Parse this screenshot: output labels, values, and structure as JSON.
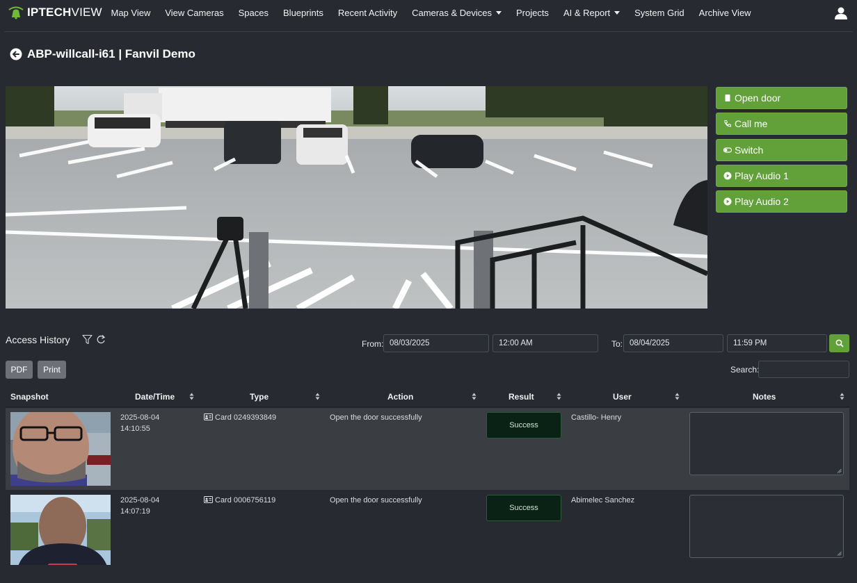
{
  "brand": {
    "bold": "IPTECH",
    "thin": "VIEW"
  },
  "nav": {
    "items": [
      {
        "label": "Map View"
      },
      {
        "label": "View Cameras"
      },
      {
        "label": "Spaces"
      },
      {
        "label": "Blueprints"
      },
      {
        "label": "Recent Activity"
      },
      {
        "label": "Cameras & Devices",
        "dropdown": true
      },
      {
        "label": "Projects"
      },
      {
        "label": "AI & Report",
        "dropdown": true
      },
      {
        "label": "System Grid"
      },
      {
        "label": "Archive View"
      }
    ]
  },
  "page": {
    "title": "ABP-willcall-i61 | Fanvil Demo"
  },
  "actions": [
    {
      "label": "Open door",
      "icon": "door-icon"
    },
    {
      "label": "Call me",
      "icon": "phone-icon"
    },
    {
      "label": "Switch",
      "icon": "toggle-icon"
    },
    {
      "label": "Play Audio 1",
      "icon": "play-circle-icon"
    },
    {
      "label": "Play Audio 2",
      "icon": "play-circle-icon"
    }
  ],
  "history": {
    "title": "Access History",
    "from_label": "From:",
    "from_date": "08/03/2025",
    "from_time": "12:00 AM",
    "to_label": "To:",
    "to_date": "08/04/2025",
    "to_time": "11:59 PM",
    "pdf_label": "PDF",
    "print_label": "Print",
    "search_label": "Search:",
    "search_value": ""
  },
  "table": {
    "columns": [
      "Snapshot",
      "Date/Time",
      "Type",
      "Action",
      "Result",
      "User",
      "Notes"
    ],
    "rows": [
      {
        "date": "2025-08-04",
        "time": "14:10:55",
        "type": "Card 0249393849",
        "action": "Open the door successfully",
        "result": "Success",
        "user": "Castillo- Henry",
        "notes": ""
      },
      {
        "date": "2025-08-04",
        "time": "14:07:19",
        "type": "Card 0006756119",
        "action": "Open the door successfully",
        "result": "Success",
        "user": "Abimelec Sanchez",
        "notes": ""
      }
    ]
  },
  "colors": {
    "bg": "#272b31",
    "accent_green": "#62a13a",
    "success_bg": "#0a2116"
  }
}
